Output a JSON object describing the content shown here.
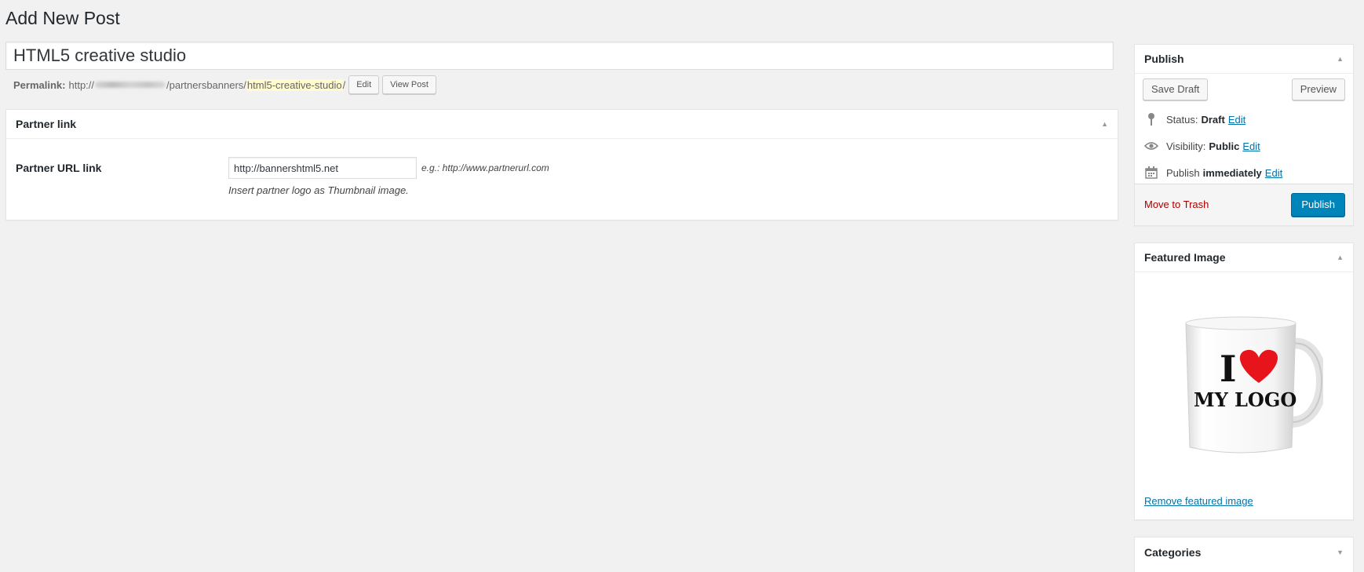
{
  "page": {
    "title": "Add New Post"
  },
  "post": {
    "title_value": "HTML5 creative studio",
    "permalink_label": "Permalink:",
    "permalink_prefix": "http://",
    "permalink_path": "/partnersbanners/",
    "permalink_slug": "html5-creative-studio",
    "permalink_trailing": "/",
    "edit_label": "Edit",
    "view_label": "View Post"
  },
  "partner_box": {
    "title": "Partner link",
    "field_label": "Partner URL link",
    "url_value": "http://bannershtml5.net",
    "url_hint": "e.g.: http://www.partnerurl.com",
    "thumb_hint": "Insert partner logo as Thumbnail image."
  },
  "publish_box": {
    "title": "Publish",
    "save_draft": "Save Draft",
    "preview": "Preview",
    "status_label": "Status:",
    "status_value": "Draft",
    "visibility_label": "Visibility:",
    "visibility_value": "Public",
    "publish_label": "Publish",
    "publish_value": "immediately",
    "edit": "Edit",
    "move_to_trash": "Move to Trash",
    "publish_button": "Publish"
  },
  "featured_box": {
    "title": "Featured Image",
    "mug_line1": "I",
    "mug_line2": "MY LOGO",
    "remove_link": "Remove featured image"
  },
  "categories_box": {
    "title": "Categories"
  },
  "colors": {
    "accent": "#0085ba",
    "link": "#0073aa",
    "trash": "#aa0000",
    "slug_highlight": "#fffbcc"
  }
}
